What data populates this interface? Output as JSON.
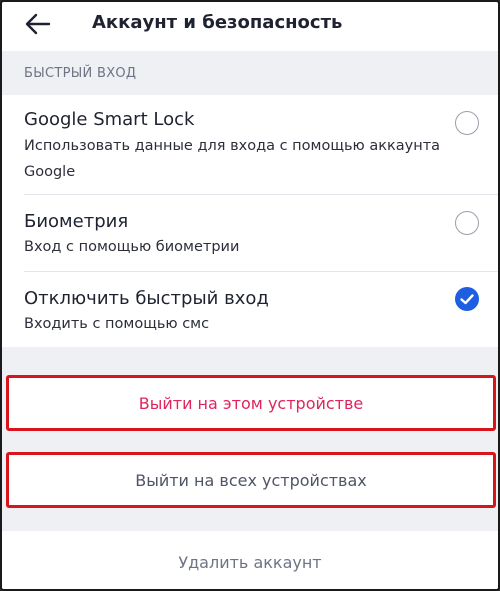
{
  "header": {
    "title": "Аккаунт и безопасность",
    "back_icon": "arrow-left-icon"
  },
  "quick_login": {
    "section_title": "БЫСТРЫЙ ВХОД",
    "options": [
      {
        "title": "Google Smart Lock",
        "subtitle": "Использовать данные для входа с помощью аккаунта Google",
        "selected": false
      },
      {
        "title": "Биометрия",
        "subtitle": "Вход с помощью биометрии",
        "selected": false
      },
      {
        "title": "Отключить быстрый вход",
        "subtitle": "Входить с помощью смс",
        "selected": true
      }
    ]
  },
  "actions": {
    "logout_this": "Выйти на этом устройстве",
    "logout_all": "Выйти на всех устройствах",
    "delete_account": "Удалить аккаунт"
  },
  "colors": {
    "accent_blue": "#1d5fe0",
    "logout_this_text": "#e0245e",
    "highlight_border": "#d8141c",
    "section_bg": "#eef0f4"
  }
}
